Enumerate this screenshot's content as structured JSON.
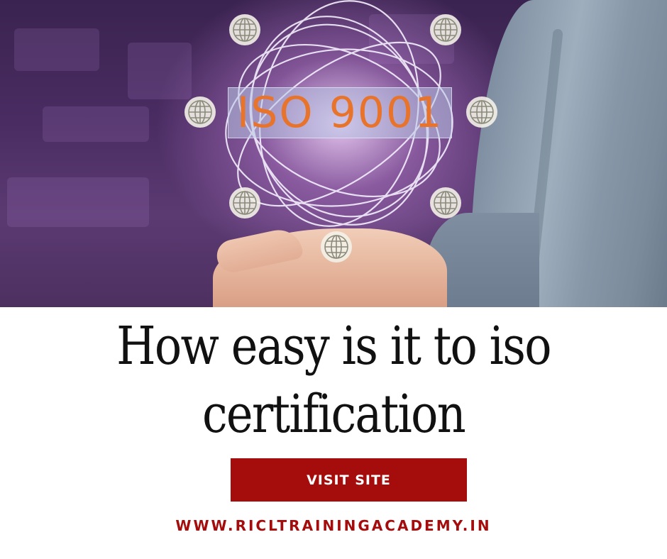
{
  "hero": {
    "badge_text": "ISO 9001",
    "accent_color": "#e8742c",
    "icons": [
      "globe-icon",
      "globe-icon",
      "globe-icon",
      "globe-icon",
      "globe-icon",
      "globe-icon",
      "globe-icon"
    ]
  },
  "headline": {
    "line1": "How easy is it to iso",
    "line2": "certification"
  },
  "cta": {
    "label": "VISIT SITE",
    "color": "#a50d0d"
  },
  "footer": {
    "url": "WWW.RICLTRAININGACADEMY.IN"
  }
}
